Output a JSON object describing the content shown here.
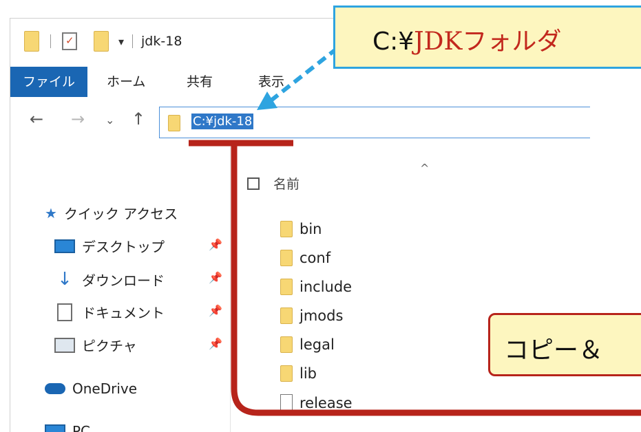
{
  "window": {
    "title": "jdk-18"
  },
  "ribbon": {
    "tabs": [
      "ファイル",
      "ホーム",
      "共有",
      "表示"
    ]
  },
  "nav": {
    "address": "C:¥jdk-18"
  },
  "sidebar": {
    "quick_access": "クイック アクセス",
    "items": [
      {
        "label": "デスクトップ",
        "icon": "desktop-icon"
      },
      {
        "label": "ダウンロード",
        "icon": "download-icon"
      },
      {
        "label": "ドキュメント",
        "icon": "documents-icon"
      },
      {
        "label": "ピクチャ",
        "icon": "pictures-icon"
      }
    ],
    "onedrive": "OneDrive",
    "pc": "PC"
  },
  "content": {
    "column_name": "名前",
    "files": [
      {
        "name": "bin",
        "type": "folder"
      },
      {
        "name": "conf",
        "type": "folder"
      },
      {
        "name": "include",
        "type": "folder"
      },
      {
        "name": "jmods",
        "type": "folder"
      },
      {
        "name": "legal",
        "type": "folder"
      },
      {
        "name": "lib",
        "type": "folder"
      },
      {
        "name": "release",
        "type": "file"
      }
    ]
  },
  "annotations": {
    "callout_top_prefix": "C:¥",
    "callout_top_red": "JDKフォルダ",
    "callout_bottom": "コピー＆"
  },
  "colors": {
    "accent_blue": "#1a66b3",
    "callout_border_blue": "#2ea4e0",
    "callout_red": "#b7241b",
    "callout_fill": "#fdf6bf"
  }
}
